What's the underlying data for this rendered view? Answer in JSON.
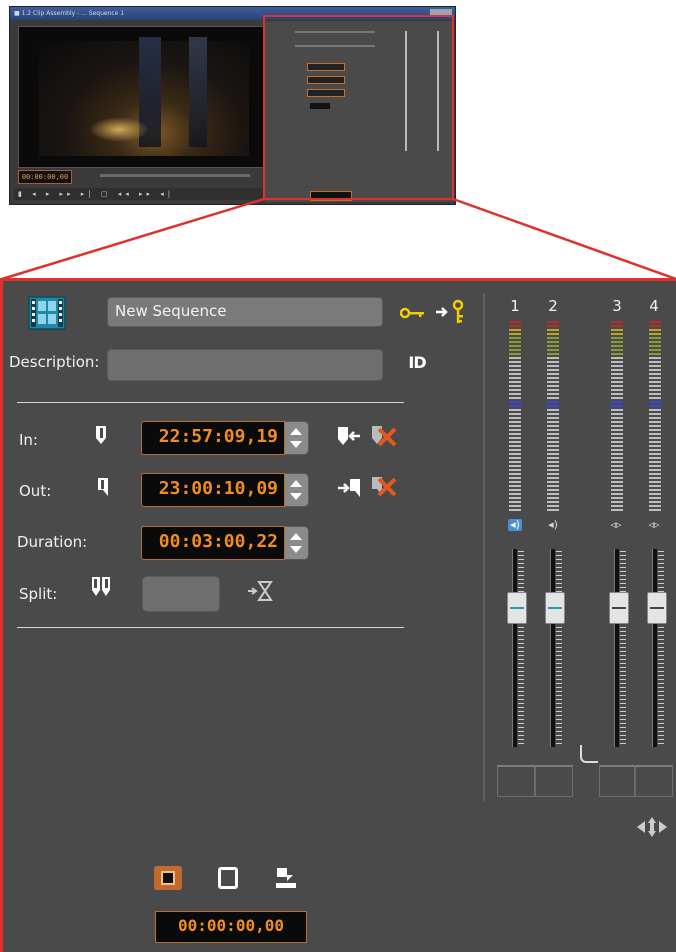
{
  "thumbnail": {
    "window_title": "■ 1.2 Clip Assembly - ... Sequence 1",
    "timecode": "00:00:00,00",
    "transport_icons": "▮ ◂ ▸ ▸▸ ▸| ▢ ◂◂ ▸▸ ◂|"
  },
  "panel": {
    "sequence_name": "New Sequence",
    "description_label": "Description:",
    "description_value": "",
    "in_label": "In:",
    "in_value": "22:57:09,19",
    "out_label": "Out:",
    "out_value": "23:00:10,09",
    "duration_label": "Duration:",
    "duration_value": "00:03:00,22",
    "split_label": "Split:",
    "split_value": "",
    "id_icon_text": "ID",
    "record_timecode": "00:00:00,00"
  },
  "mixer": {
    "channels": [
      {
        "number": "1",
        "speaker_active": true
      },
      {
        "number": "2",
        "speaker_active": false
      },
      {
        "number": "3",
        "speaker_active": false
      },
      {
        "number": "4",
        "speaker_active": false
      }
    ]
  },
  "colors": {
    "panel_bg": "#4a4a4a",
    "highlight_red": "#e0302a",
    "timecode_orange": "#f08c20",
    "key_yellow": "#f0d000",
    "delete_orange": "#e05a20",
    "speaker_blue": "#4a90d8",
    "fader_cyan": "#20a0a0"
  }
}
